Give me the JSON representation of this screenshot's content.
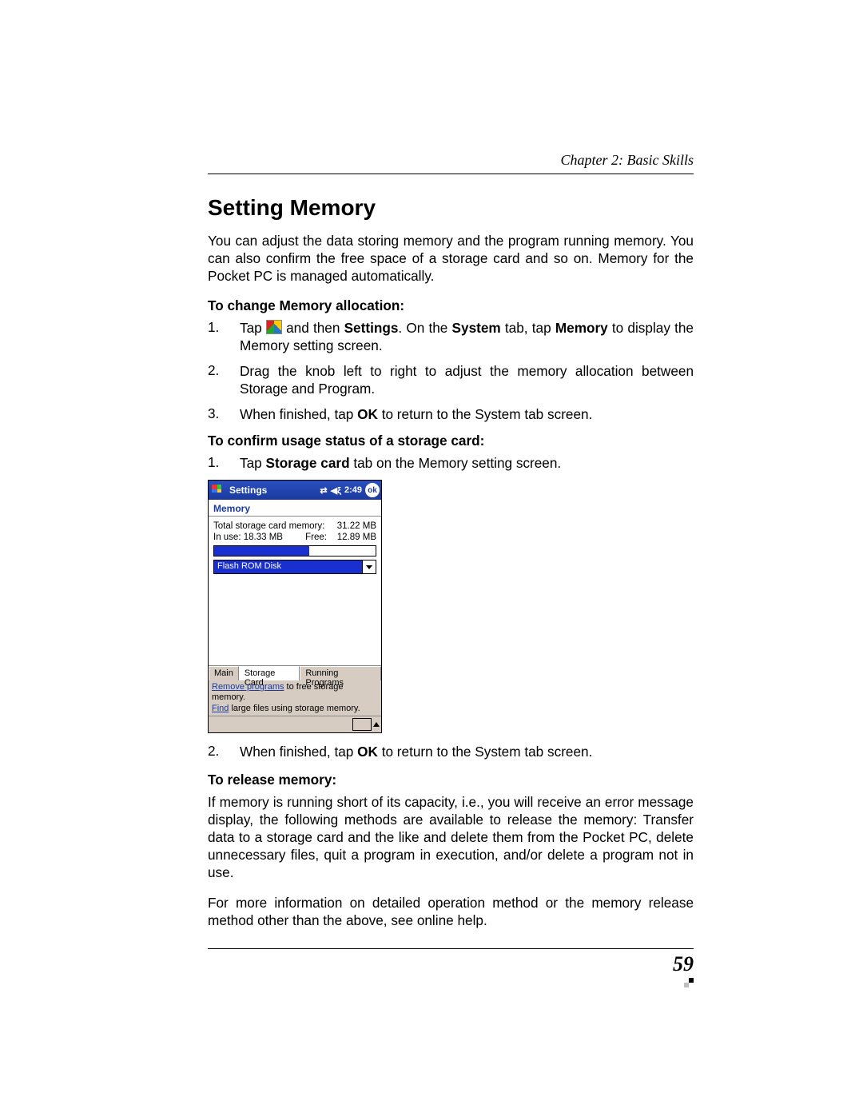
{
  "header": {
    "chapter": "Chapter 2: Basic Skills"
  },
  "title": "Setting  Memory",
  "intro": "You can adjust the data storing memory and the program running memory. You can also confirm the free space of a storage card and so on. Memory for the Pocket PC is managed automatically.",
  "sec1": {
    "heading": "To change Memory allocation:",
    "step1a": "Tap ",
    "step1b": " and then ",
    "step1_settings": "Settings",
    "step1c": ". On the ",
    "step1_system": "System",
    "step1d": " tab, tap ",
    "step1_memory": "Memory",
    "step1e": " to display the Memory setting screen.",
    "step2": "Drag the knob left to right to adjust the memory allocation between Storage and Program.",
    "step3a": "When finished, tap ",
    "step3_ok": "OK",
    "step3b": " to return to the System tab screen."
  },
  "sec2": {
    "heading": "To confirm usage status of a storage card:",
    "step1a": "Tap ",
    "step1_sc": "Storage card",
    "step1b": " tab on the Memory setting screen.",
    "step2a": "When finished, tap ",
    "step2_ok": "OK",
    "step2b": " to return to the System tab screen."
  },
  "ppc": {
    "titlebar": "Settings",
    "time": "2:49",
    "ok": "ok",
    "subtitle": "Memory",
    "total_label": "Total storage card memory:",
    "total_value": "31.22 MB",
    "inuse_label": "In use:",
    "inuse_value": "18.33 MB",
    "free_label": "Free:",
    "free_value": "12.89 MB",
    "select_value": "Flash ROM Disk",
    "tabs": {
      "main": "Main",
      "storage": "Storage Card",
      "running": "Running Programs"
    },
    "link1a": "Remove programs",
    "link1b": " to free storage memory.",
    "link2a": "Find",
    "link2b": " large files using storage memory."
  },
  "sec3": {
    "heading": "To release memory:",
    "p1": "If memory is running short of its capacity, i.e., you will receive an error message display, the following methods are available to release the memory: Transfer data to a storage card and the like and delete them from the Pocket PC, delete unnecessary files, quit a program in execution, and/or delete a program not in use.",
    "p2": "For more information on detailed operation method or the memory release method other than the above, see online help."
  },
  "page_number": "59",
  "num": {
    "n1": "1.",
    "n2": "2.",
    "n3": "3."
  }
}
